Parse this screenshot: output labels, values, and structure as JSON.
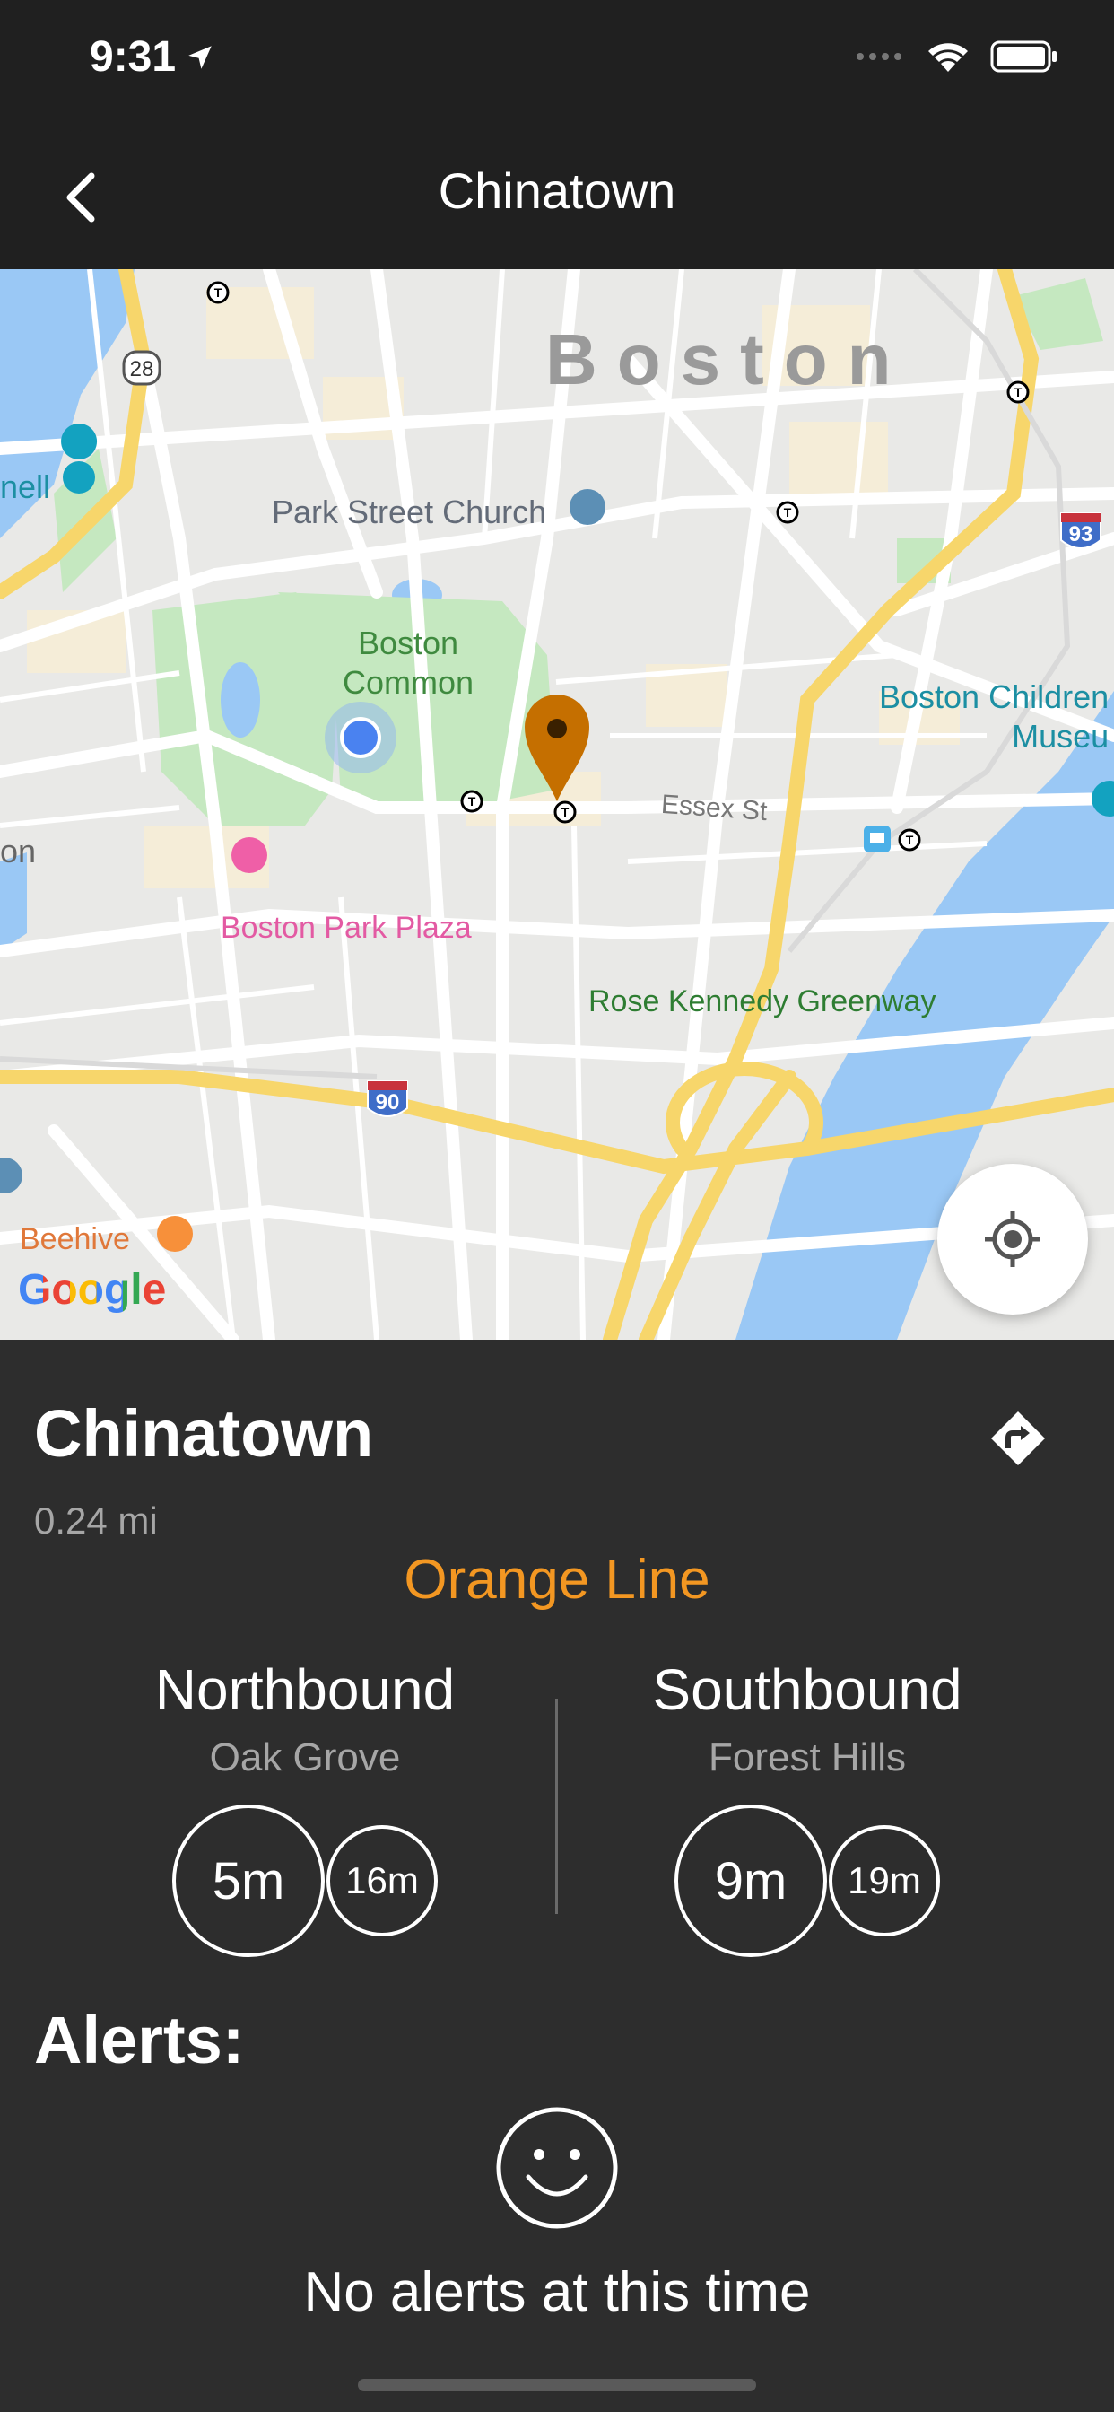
{
  "status_bar": {
    "time": "9:31",
    "icons": [
      "location-arrow-icon",
      "signal-icon",
      "wifi-icon",
      "battery-icon"
    ]
  },
  "nav": {
    "title": "Chinatown",
    "back_icon": "chevron-left-icon"
  },
  "map": {
    "labels": {
      "city": "Boston",
      "park_street_church": "Park Street Church",
      "boston_common_1": "Boston",
      "boston_common_2": "Common",
      "essex_st": "Essex St",
      "boston_childrens_1": "Boston Children",
      "boston_childrens_2": "Museu",
      "boston_park_plaza": "Boston Park Plaza",
      "rose_kennedy": "Rose Kennedy Greenway",
      "beehive": "Beehive",
      "left_edge_1": "nell",
      "left_edge_2": "on",
      "route_28": "28",
      "route_93": "93",
      "route_90": "90",
      "google": "Google"
    },
    "colors": {
      "land": "#e9e9e7",
      "park": "#c5e8c0",
      "water": "#9ac8f5",
      "highway": "#f7d66b",
      "station_pin": "#c56f00"
    }
  },
  "station": {
    "name": "Chinatown",
    "distance": "0.24 mi",
    "line": "Orange Line",
    "line_color": "#f39722",
    "directions_icon": "directions-icon"
  },
  "directions": [
    {
      "name": "Northbound",
      "destination": "Oak Grove",
      "next": "5m",
      "following": "16m"
    },
    {
      "name": "Southbound",
      "destination": "Forest Hills",
      "next": "9m",
      "following": "19m"
    }
  ],
  "alerts": {
    "heading": "Alerts:",
    "message": "No alerts at this time",
    "icon": "smiley-icon"
  }
}
